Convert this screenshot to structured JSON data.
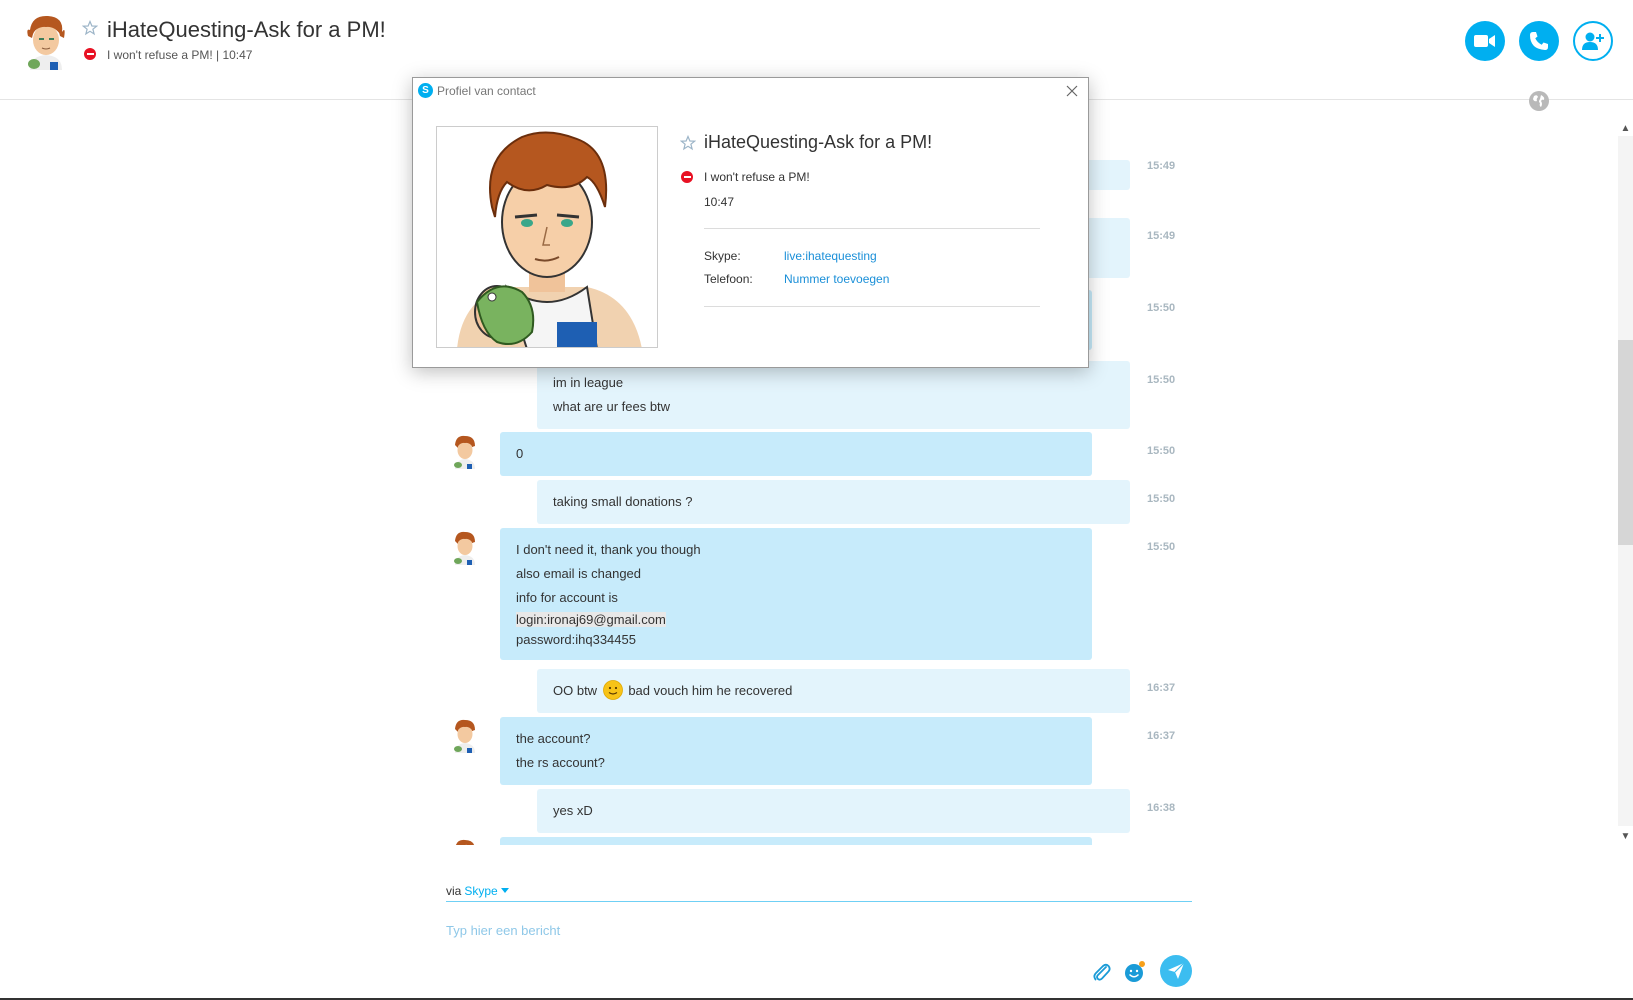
{
  "header": {
    "title": "iHateQuesting-Ask for a PM!",
    "status": "I won't refuse a PM!  |  10:47"
  },
  "messages": [
    {
      "type": "in",
      "lines": [
        "0"
      ],
      "time": "15:50"
    },
    {
      "type": "out",
      "lines": [
        "taking small donations ?"
      ],
      "time": "15:50"
    },
    {
      "type": "in",
      "lines": [
        "I don't need it, thank you though",
        "also email is changed",
        "info for account is",
        "login:ironaj69@gmail.com",
        "password:ihq334455"
      ],
      "time": "15:50"
    },
    {
      "type": "out",
      "lines": [
        "OO btw",
        "bad vouch him he recovered"
      ],
      "time": "16:37"
    },
    {
      "type": "in",
      "lines": [
        "the account?",
        "the rs account?"
      ],
      "time": "16:37"
    },
    {
      "type": "out",
      "lines": [
        "yes xD"
      ],
      "time": "16:38"
    }
  ],
  "partial_messages": {
    "out_1": {
      "lines": [
        "im in league",
        "what are ur fees btw"
      ],
      "time": "15:50"
    },
    "times_above": [
      "15:49",
      "15:49",
      "15:50"
    ]
  },
  "composer": {
    "via": "via",
    "via_service": "Skype",
    "placeholder": "Typ hier een bericht"
  },
  "dialog": {
    "title": "Profiel van contact",
    "name": "iHateQuesting-Ask for a PM!",
    "status": "I won't refuse a PM!",
    "time": "10:47",
    "skype_label": "Skype:",
    "skype_value": "live:ihatequesting",
    "phone_label": "Telefoon:",
    "phone_value": "Nummer toevoegen"
  },
  "colors": {
    "accent": "#00aff0",
    "incoming_bubble": "#c7ebfb",
    "outgoing_bubble": "#e3f4fc",
    "status_busy": "#e81123"
  },
  "icons": {
    "video": "video-call-icon",
    "call": "phone-call-icon",
    "add": "add-contact-icon",
    "attach": "paperclip-icon",
    "emoticon": "emoticon-icon",
    "send": "send-icon"
  }
}
